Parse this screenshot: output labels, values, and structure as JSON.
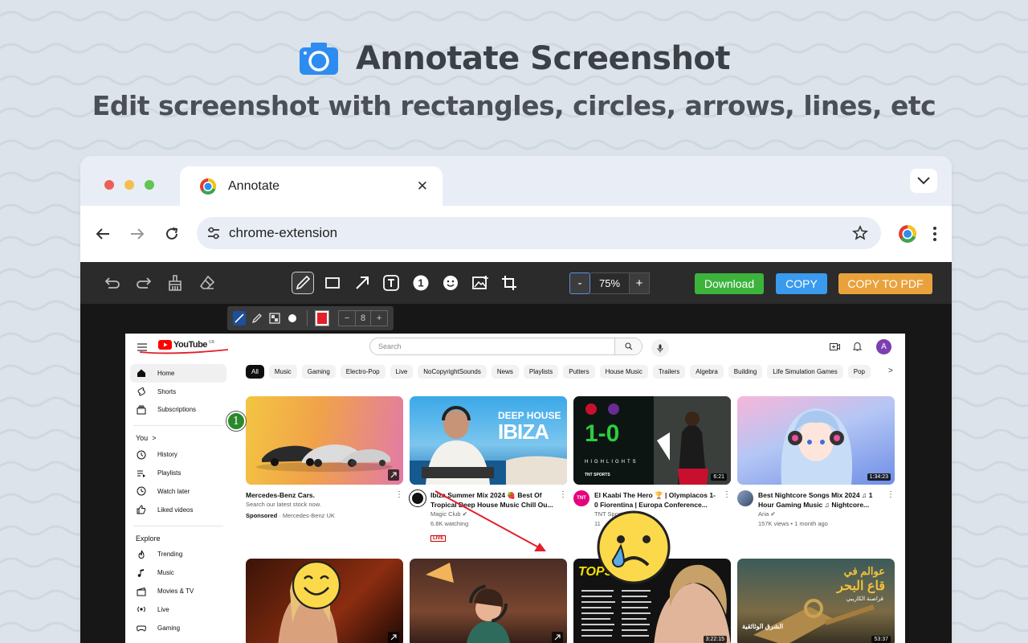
{
  "hero": {
    "title": "Annotate Screenshot",
    "subtitle": "Edit screenshot with rectangles, circles, arrows, lines, etc"
  },
  "browser": {
    "tab_title": "Annotate",
    "tab_close": "✕",
    "url": "chrome-extension"
  },
  "toolbar": {
    "zoom_minus": "-",
    "zoom_value": "75%",
    "zoom_plus": "+",
    "download_label": "Download",
    "copy_label": "COPY",
    "copy_pdf_label": "COPY TO PDF",
    "step_number": "1",
    "colors": {
      "download": "#3cb43c",
      "copy": "#3a9aee",
      "copy_pdf": "#e9a23b"
    }
  },
  "subtool": {
    "minus": "−",
    "size": "8",
    "plus": "+",
    "color": "#e41e2b"
  },
  "annotation": {
    "step_marker": "1"
  },
  "youtube": {
    "logo_text": "YouTube",
    "logo_sup": "GB",
    "search_placeholder": "Search",
    "avatar_letter": "A",
    "sidebar_main": [
      {
        "label": "Home",
        "icon": "home-icon"
      },
      {
        "label": "Shorts",
        "icon": "shorts-icon"
      },
      {
        "label": "Subscriptions",
        "icon": "subscriptions-icon"
      }
    ],
    "you_label": "You",
    "you_chevron": ">",
    "sidebar_you": [
      {
        "label": "History",
        "icon": "history-icon"
      },
      {
        "label": "Playlists",
        "icon": "playlists-icon"
      },
      {
        "label": "Watch later",
        "icon": "clock-icon"
      },
      {
        "label": "Liked videos",
        "icon": "thumb-up-icon"
      }
    ],
    "explore_label": "Explore",
    "sidebar_explore": [
      {
        "label": "Trending",
        "icon": "fire-icon"
      },
      {
        "label": "Music",
        "icon": "music-icon"
      },
      {
        "label": "Movies & TV",
        "icon": "clapper-icon"
      },
      {
        "label": "Live",
        "icon": "live-icon"
      },
      {
        "label": "Gaming",
        "icon": "gamepad-icon"
      }
    ],
    "chips": [
      "All",
      "Music",
      "Gaming",
      "Electro-Pop",
      "Live",
      "NoCopyrightSounds",
      "News",
      "Playlists",
      "Putters",
      "House Music",
      "Trailers",
      "Algebra",
      "Building",
      "Life Simulation Games",
      "Pop"
    ],
    "chips_next": ">",
    "videos": [
      {
        "title": "Mercedes-Benz Cars.",
        "line2": "Search our latest stock now.",
        "sponsored": "Sponsored",
        "channel": "· Mercedes-Benz UK",
        "duration": ""
      },
      {
        "title": "Ibiza Summer Mix 2024 🍓 Best Of Tropical Deep House Music Chill Ou...",
        "line2": "Magic Club ✔",
        "views": "6.8K watching",
        "badge": "LIVE",
        "thumb_text_1": "DEEP HOUSE",
        "thumb_text_2": "IBIZA"
      },
      {
        "title": "El Kaabi The Hero 🏆 | Olympiacos 1-0 Fiorentina | Europa Conference...",
        "line2": "TNT Sports",
        "views": "11",
        "duration": "6:21",
        "thumb_score": "1-0",
        "thumb_caption": "HIGHLIGHTS",
        "thumb_brand": "TNT SPORTS",
        "avatar_text": "TNT"
      },
      {
        "title": "Best Nightcore Songs Mix 2024 ♫ 1 Hour Gaming Music ♫ Nightcore...",
        "line2": "Aria ✔",
        "views": "157K views • 1 month ago",
        "duration": "1:34:23"
      }
    ],
    "row2": [
      {
        "duration": ""
      },
      {
        "duration": ""
      },
      {
        "duration": "3:22:15",
        "thumb_text": "TOPS"
      },
      {
        "duration": "53:37",
        "thumb_text_1": "عوالم في",
        "thumb_text_2": "قاع البحر",
        "thumb_text_3": "قراصنة الكاريبي",
        "thumb_brand": "الشرق الوثائقية"
      }
    ]
  }
}
